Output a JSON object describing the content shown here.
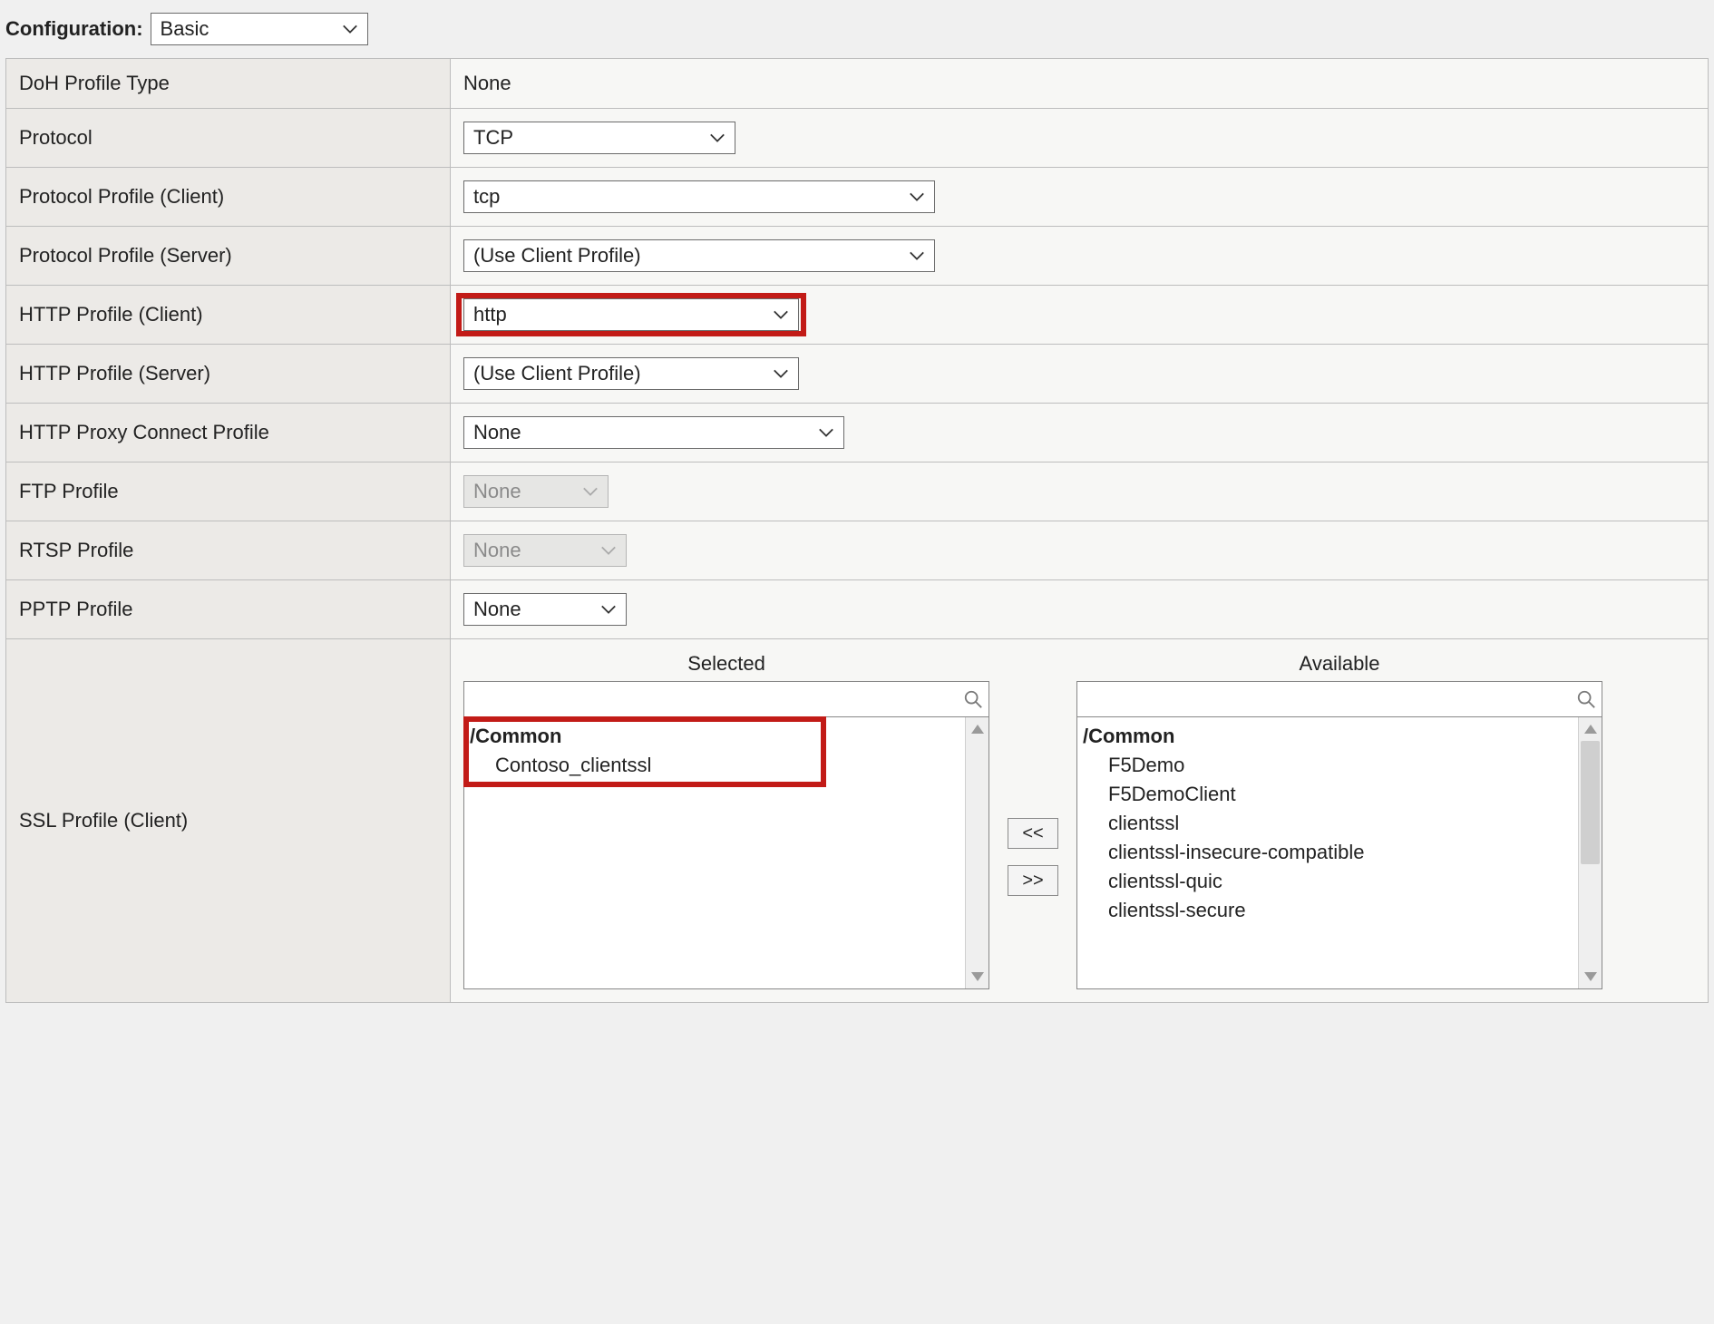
{
  "config_head": {
    "label": "Configuration:",
    "select_value": "Basic"
  },
  "rows": {
    "doh": {
      "label": "DoH Profile Type",
      "value": "None"
    },
    "protocol": {
      "label": "Protocol",
      "value": "TCP"
    },
    "protocol_profile_client": {
      "label": "Protocol Profile (Client)",
      "value": "tcp"
    },
    "protocol_profile_server": {
      "label": "Protocol Profile (Server)",
      "value": "(Use Client Profile)"
    },
    "http_profile_client": {
      "label": "HTTP Profile (Client)",
      "value": "http"
    },
    "http_profile_server": {
      "label": "HTTP Profile (Server)",
      "value": "(Use Client Profile)"
    },
    "http_proxy_connect": {
      "label": "HTTP Proxy Connect Profile",
      "value": "None"
    },
    "ftp_profile": {
      "label": "FTP Profile",
      "value": "None"
    },
    "rtsp_profile": {
      "label": "RTSP Profile",
      "value": "None"
    },
    "pptp_profile": {
      "label": "PPTP Profile",
      "value": "None"
    }
  },
  "ssl": {
    "label": "SSL Profile (Client)",
    "selected": {
      "title": "Selected",
      "group": "/Common",
      "items": [
        "Contoso_clientssl"
      ]
    },
    "available": {
      "title": "Available",
      "group": "/Common",
      "items": [
        "F5Demo",
        "F5DemoClient",
        "clientssl",
        "clientssl-insecure-compatible",
        "clientssl-quic",
        "clientssl-secure"
      ]
    },
    "move_left": "<<",
    "move_right": ">>"
  }
}
